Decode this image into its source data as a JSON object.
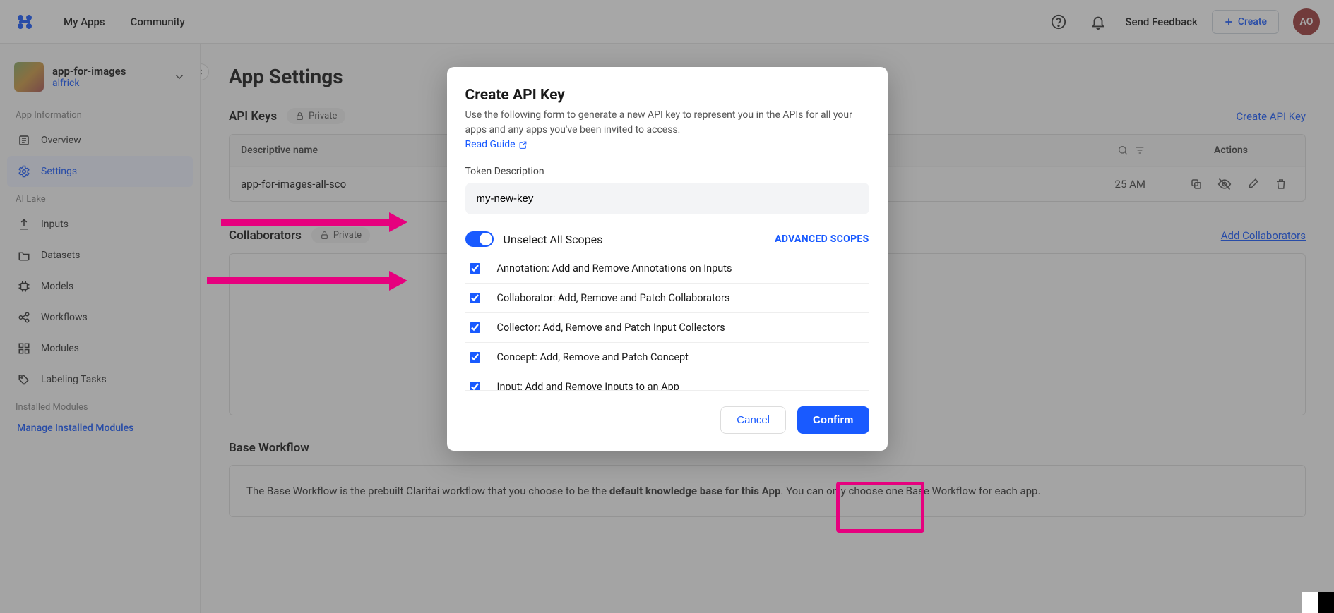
{
  "topbar": {
    "nav": {
      "my_apps": "My Apps",
      "community": "Community"
    },
    "feedback": "Send Feedback",
    "create": "Create",
    "avatar": "AO"
  },
  "sidebar": {
    "app_name": "app-for-images",
    "app_user": "alfrick",
    "section_app_info": "App Information",
    "items_app_info": {
      "overview": "Overview",
      "settings": "Settings"
    },
    "section_ai_lake": "AI Lake",
    "items_lake": {
      "inputs": "Inputs",
      "datasets": "Datasets",
      "models": "Models",
      "workflows": "Workflows",
      "modules": "Modules",
      "labeling": "Labeling Tasks"
    },
    "section_installed": "Installed Modules",
    "manage": "Manage Installed Modules"
  },
  "main": {
    "page_title": "App Settings",
    "api_keys_title": "API Keys",
    "private_badge": "Private",
    "create_api_link": "Create API Key",
    "table": {
      "th_name": "Descriptive name",
      "th_actions": "Actions",
      "row_name": "app-for-images-all-sco",
      "row_time": "25 AM"
    },
    "collaborators_title": "Collaborators",
    "add_collab_link": "Add Collaborators",
    "workflow_title": "Base Workflow",
    "workflow_text_a": "The Base Workflow is the prebuilt Clarifai workflow that you choose to be the ",
    "workflow_text_b": "default knowledge base for this App",
    "workflow_text_c": ". You can only choose one Base Workflow for each app."
  },
  "modal": {
    "title": "Create API Key",
    "desc": "Use the following form to generate a new API key to represent you in the APIs for all your apps and any apps you've been invited to access.",
    "guide": "Read Guide",
    "field_label": "Token Description",
    "input_value": "my-new-key",
    "unselect_label": "Unselect All Scopes",
    "advanced": "ADVANCED SCOPES",
    "scopes": [
      "Annotation: Add and Remove Annotations on Inputs",
      "Collaborator: Add, Remove and Patch Collaborators",
      "Collector: Add, Remove and Patch Input Collectors",
      "Concept: Add, Remove and Patch Concept",
      "Input: Add and Remove Inputs to an App"
    ],
    "cancel": "Cancel",
    "confirm": "Confirm"
  }
}
